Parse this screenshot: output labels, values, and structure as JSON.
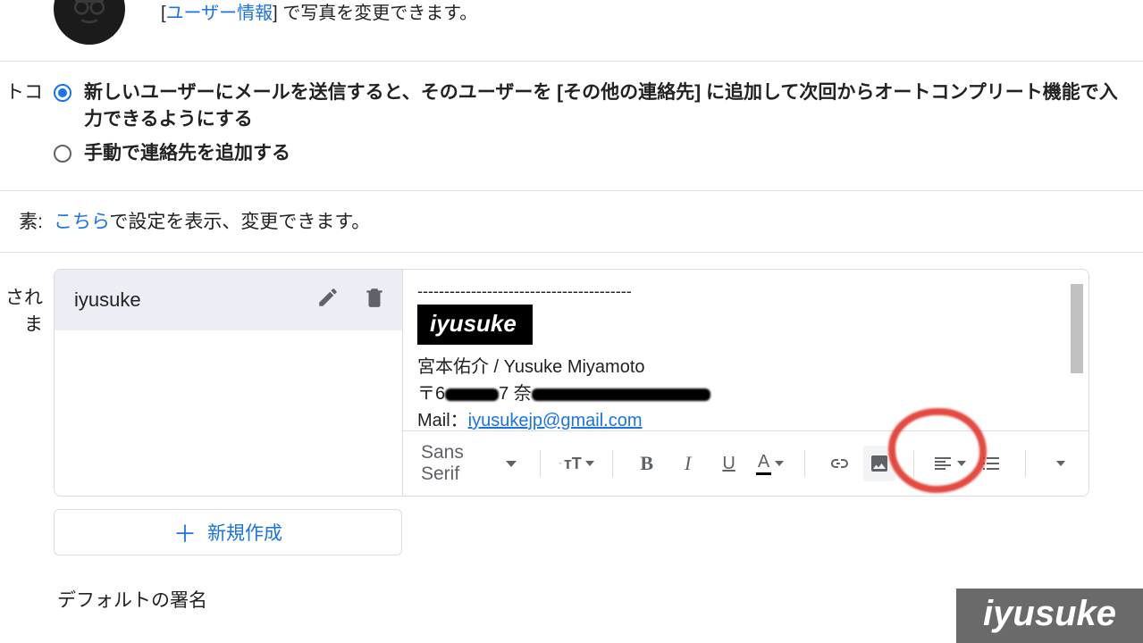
{
  "avatar": {
    "link_text": "ユーザー情報",
    "suffix": "] で写真を変更できます。",
    "prefix": "["
  },
  "contacts": {
    "label_fragment": "トコ",
    "option_auto": "新しいユーザーにメールを送信すると、そのユーザーを [その他の連絡先] に追加して次回からオートコンプリート機能で入力できるようにする",
    "option_manual": "手動で連絡先を追加する"
  },
  "settings_link": {
    "label_fragment": "素:",
    "link": "こちら",
    "rest": "で設定を表示、変更できます。"
  },
  "signature": {
    "label_fragment": "されま",
    "name": "iyusuke",
    "divider": "----------------------------------------",
    "logo": "iyusuke",
    "real_name": "宮本佑介 / Yusuke Miyamoto",
    "addr_prefix": "〒6",
    "addr_mid": "7 奈",
    "mail_label": "Mail：",
    "email": "iyusukejp@gmail.com",
    "font_name": "Sans Serif",
    "new_label": "新規作成",
    "default_label": "デフォルトの署名"
  },
  "watermark": "iyusuke"
}
